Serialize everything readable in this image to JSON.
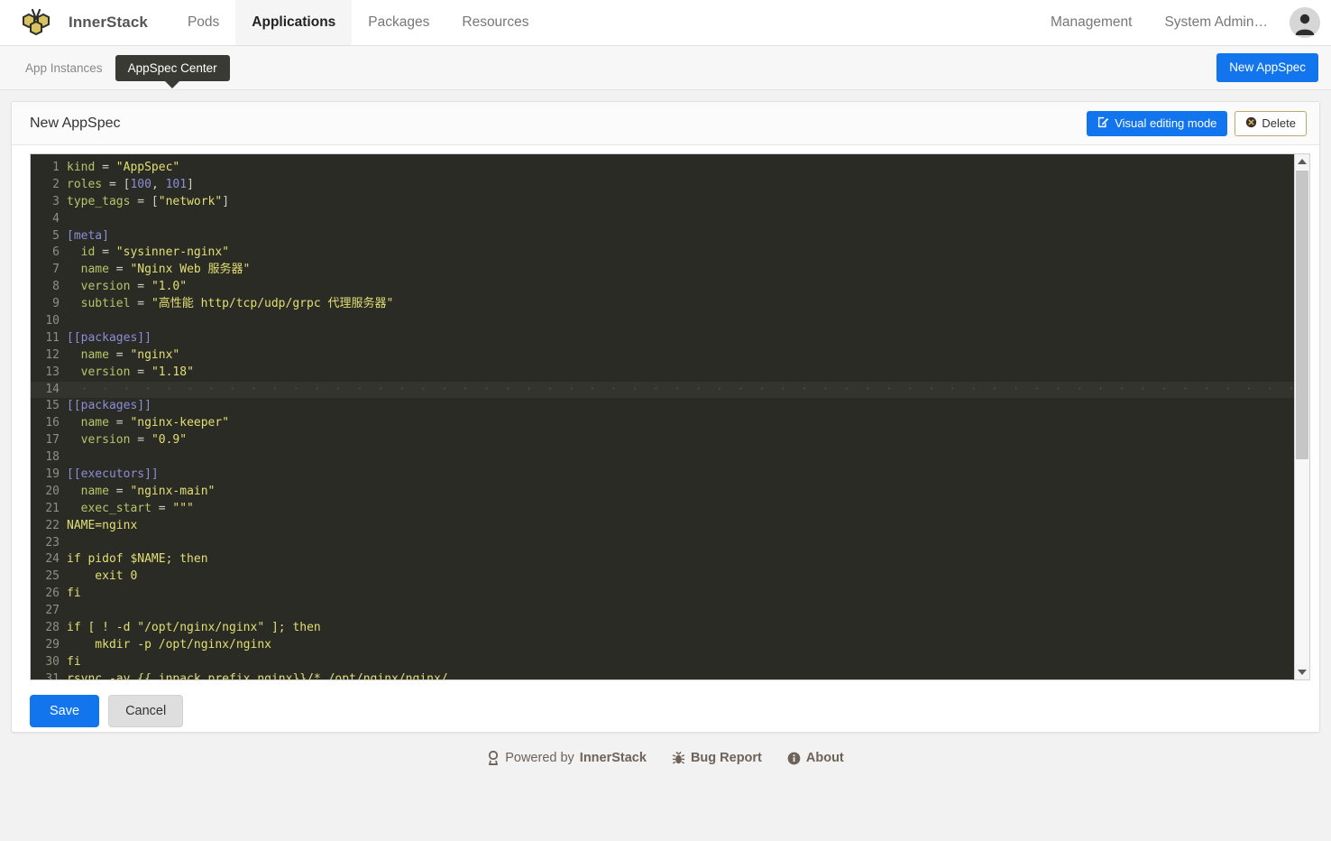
{
  "header": {
    "brand": "InnerStack",
    "logo_icon": "bee-honeycomb-logo",
    "nav": [
      {
        "label": "Pods",
        "active": false
      },
      {
        "label": "Applications",
        "active": true
      },
      {
        "label": "Packages",
        "active": false
      },
      {
        "label": "Resources",
        "active": false
      }
    ],
    "right": [
      {
        "label": "Management"
      },
      {
        "label": "System Admin…"
      }
    ],
    "avatar_icon": "user-avatar-icon"
  },
  "subbar": {
    "tabs": [
      {
        "label": "App Instances",
        "active": false
      },
      {
        "label": "AppSpec Center",
        "active": true
      }
    ],
    "new_button": "New AppSpec"
  },
  "panel": {
    "title": "New AppSpec",
    "visual_mode_button": "Visual editing mode",
    "visual_mode_icon": "pencil-square-icon",
    "delete_button": "Delete",
    "delete_icon": "circle-x-icon",
    "save_button": "Save",
    "cancel_button": "Cancel"
  },
  "editor": {
    "active_line": 14,
    "colors": {
      "background": "#2b2b26",
      "active_line": "#34342e",
      "gutter_text": "#8f8f84",
      "key": "#b6c46a",
      "string": "#e2df73",
      "number": "#8c8cd8",
      "section": "#8c8cd8"
    },
    "lines": [
      {
        "n": 1,
        "tokens": [
          {
            "t": "key",
            "v": "kind"
          },
          {
            "t": "op",
            "v": " = "
          },
          {
            "t": "str",
            "v": "\"AppSpec\""
          }
        ]
      },
      {
        "n": 2,
        "tokens": [
          {
            "t": "key",
            "v": "roles"
          },
          {
            "t": "op",
            "v": " = ["
          },
          {
            "t": "num",
            "v": "100"
          },
          {
            "t": "op",
            "v": ", "
          },
          {
            "t": "num",
            "v": "101"
          },
          {
            "t": "op",
            "v": "]"
          }
        ]
      },
      {
        "n": 3,
        "tokens": [
          {
            "t": "key",
            "v": "type_tags"
          },
          {
            "t": "op",
            "v": " = ["
          },
          {
            "t": "str",
            "v": "\"network\""
          },
          {
            "t": "op",
            "v": "]"
          }
        ]
      },
      {
        "n": 4,
        "tokens": []
      },
      {
        "n": 5,
        "tokens": [
          {
            "t": "sec",
            "v": "[meta]"
          }
        ]
      },
      {
        "n": 6,
        "tokens": [
          {
            "t": "key",
            "v": "  id"
          },
          {
            "t": "op",
            "v": " = "
          },
          {
            "t": "str",
            "v": "\"sysinner-nginx\""
          }
        ]
      },
      {
        "n": 7,
        "tokens": [
          {
            "t": "key",
            "v": "  name"
          },
          {
            "t": "op",
            "v": " = "
          },
          {
            "t": "str",
            "v": "\"Nginx Web 服务器\""
          }
        ]
      },
      {
        "n": 8,
        "tokens": [
          {
            "t": "key",
            "v": "  version"
          },
          {
            "t": "op",
            "v": " = "
          },
          {
            "t": "str",
            "v": "\"1.0\""
          }
        ]
      },
      {
        "n": 9,
        "tokens": [
          {
            "t": "key",
            "v": "  subtiel"
          },
          {
            "t": "op",
            "v": " = "
          },
          {
            "t": "str",
            "v": "\"高性能 http/tcp/udp/grpc 代理服务器\""
          }
        ]
      },
      {
        "n": 10,
        "tokens": []
      },
      {
        "n": 11,
        "tokens": [
          {
            "t": "sec",
            "v": "[[packages]]"
          }
        ]
      },
      {
        "n": 12,
        "tokens": [
          {
            "t": "key",
            "v": "  name"
          },
          {
            "t": "op",
            "v": " = "
          },
          {
            "t": "str",
            "v": "\"nginx\""
          }
        ]
      },
      {
        "n": 13,
        "tokens": [
          {
            "t": "key",
            "v": "  version"
          },
          {
            "t": "op",
            "v": " = "
          },
          {
            "t": "str",
            "v": "\"1.18\""
          }
        ]
      },
      {
        "n": 14,
        "tokens": [
          {
            "t": "guide",
            "v": "  ·  ·  ·  ·  ·  ·  ·  ·  ·  ·  ·  ·  ·  ·  ·  ·  ·  ·  ·  ·  ·  ·  ·  ·  ·  ·  ·  ·  ·  ·  ·  ·  ·  ·  ·  ·  ·  ·  ·  ·  ·  ·  ·  ·  ·  ·  ·  ·  ·  ·  ·  ·  ·  ·  ·  ·  ·  ·  ·  ·  ·  ·  ·  ·  ·  ·  ·  ·  ·  ·"
          }
        ]
      },
      {
        "n": 15,
        "tokens": [
          {
            "t": "sec",
            "v": "[[packages]]"
          }
        ]
      },
      {
        "n": 16,
        "tokens": [
          {
            "t": "key",
            "v": "  name"
          },
          {
            "t": "op",
            "v": " = "
          },
          {
            "t": "str",
            "v": "\"nginx-keeper\""
          }
        ]
      },
      {
        "n": 17,
        "tokens": [
          {
            "t": "key",
            "v": "  version"
          },
          {
            "t": "op",
            "v": " = "
          },
          {
            "t": "str",
            "v": "\"0.9\""
          }
        ]
      },
      {
        "n": 18,
        "tokens": []
      },
      {
        "n": 19,
        "tokens": [
          {
            "t": "sec",
            "v": "[[executors]]"
          }
        ]
      },
      {
        "n": 20,
        "tokens": [
          {
            "t": "key",
            "v": "  name"
          },
          {
            "t": "op",
            "v": " = "
          },
          {
            "t": "str",
            "v": "\"nginx-main\""
          }
        ]
      },
      {
        "n": 21,
        "tokens": [
          {
            "t": "key",
            "v": "  exec_start"
          },
          {
            "t": "op",
            "v": " = "
          },
          {
            "t": "str",
            "v": "\"\"\""
          }
        ]
      },
      {
        "n": 22,
        "tokens": [
          {
            "t": "str",
            "v": "NAME=nginx"
          }
        ]
      },
      {
        "n": 23,
        "tokens": []
      },
      {
        "n": 24,
        "tokens": [
          {
            "t": "str",
            "v": "if pidof $NAME; then"
          }
        ]
      },
      {
        "n": 25,
        "tokens": [
          {
            "t": "str",
            "v": "    exit 0"
          }
        ]
      },
      {
        "n": 26,
        "tokens": [
          {
            "t": "str",
            "v": "fi"
          }
        ]
      },
      {
        "n": 27,
        "tokens": []
      },
      {
        "n": 28,
        "tokens": [
          {
            "t": "str",
            "v": "if [ ! -d \"/opt/nginx/nginx\" ]; then"
          }
        ]
      },
      {
        "n": 29,
        "tokens": [
          {
            "t": "str",
            "v": "    mkdir -p /opt/nginx/nginx"
          }
        ]
      },
      {
        "n": 30,
        "tokens": [
          {
            "t": "str",
            "v": "fi"
          }
        ]
      },
      {
        "n": 31,
        "tokens": [
          {
            "t": "str",
            "v": "rsync -av {{.inpack_prefix_nginx}}/* /opt/nginx/nginx/"
          }
        ]
      }
    ]
  },
  "footer": {
    "items": [
      {
        "icon": "badge-icon",
        "pre": "Powered by ",
        "bold": "InnerStack"
      },
      {
        "icon": "bug-icon",
        "pre": "",
        "bold": "Bug Report"
      },
      {
        "icon": "info-icon",
        "pre": "",
        "bold": "About"
      }
    ]
  }
}
